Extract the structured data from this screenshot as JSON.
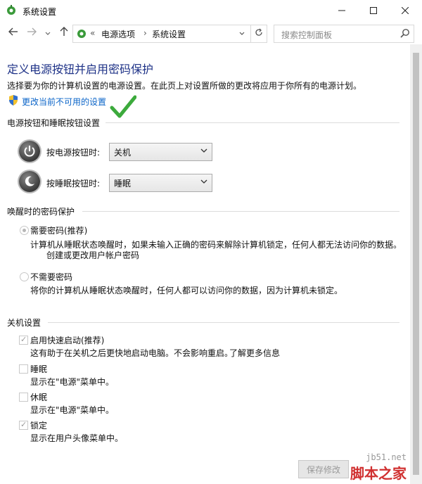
{
  "window": {
    "title": "系统设置",
    "controls": [
      "minimize-icon",
      "maximize-icon",
      "close-icon"
    ]
  },
  "address_bar": {
    "nav_icons": [
      "back-arrow-icon",
      "forward-arrow-icon",
      "chevron-down-icon",
      "up-arrow-icon"
    ],
    "overflow": "«",
    "breadcrumbs": [
      "电源选项",
      "系统设置"
    ],
    "search_placeholder": "搜索控制面板"
  },
  "main": {
    "heading": "定义电源按钮并启用密码保护",
    "description": "选择要为你的计算机设置的电源设置。在此页上对设置所做的更改将应用于你所有的电源计划。",
    "change_settings_link": "更改当前不可用的设置",
    "power_section": {
      "title": "电源按钮和睡眠按钮设置",
      "rows": [
        {
          "label": "按电源按钮时:",
          "value": "关机",
          "icon": "power-button-icon"
        },
        {
          "label": "按睡眠按钮时:",
          "value": "睡眠",
          "icon": "sleep-button-icon"
        }
      ]
    },
    "password_section": {
      "title": "唤醒时的密码保护",
      "option1_label": "需要密码(推荐)",
      "option1_selected": true,
      "option1_desc": "计算机从睡眠状态唤醒时，如果未输入正确的密码来解除计算机锁定，任何人都无法访问你的数据。",
      "option1_link": "创建或更改用户帐户密码",
      "option2_label": "不需要密码",
      "option2_selected": false,
      "option2_desc": "将你的计算机从睡眠状态唤醒时，任何人都可以访问你的数据，因为计算机未锁定。"
    },
    "shutdown_section": {
      "title": "关机设置",
      "items": [
        {
          "label": "启用快速启动(推荐)",
          "checked": true,
          "desc": "这有助于在关机之后更快地启动电脑。不会影响重启。",
          "link": "了解更多信息"
        },
        {
          "label": "睡眠",
          "checked": false,
          "desc": "显示在\"电源\"菜单中。"
        },
        {
          "label": "休眠",
          "checked": false,
          "desc": "显示在\"电源\"菜单中。"
        },
        {
          "label": "锁定",
          "checked": true,
          "desc": "显示在用户头像菜单中。"
        }
      ]
    },
    "save_button": "保存修改"
  },
  "watermark": {
    "site": "jb51.net",
    "name": "脚本之家"
  },
  "colors": {
    "heading": "#1e3287",
    "link": "#0a64c8",
    "check_overlay": "#3caa3c",
    "watermark": "#d03030"
  }
}
